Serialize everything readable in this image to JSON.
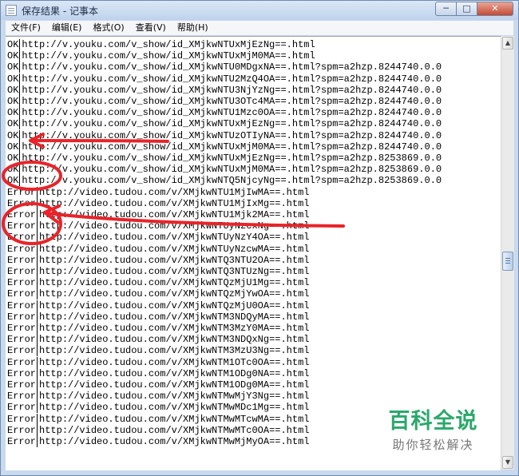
{
  "window": {
    "title": "保存结果 - 记事本",
    "minimize_glyph": "─",
    "maximize_glyph": "□",
    "close_glyph": "✕"
  },
  "menu": [
    {
      "label": "文件(F)"
    },
    {
      "label": "编辑(E)"
    },
    {
      "label": "格式(O)"
    },
    {
      "label": "查看(V)"
    },
    {
      "label": "帮助(H)"
    }
  ],
  "lines": [
    {
      "status": "OK",
      "url": "http://v.youku.com/v_show/id_XMjkwNTUxMjEzNg==.html"
    },
    {
      "status": "OK",
      "url": "http://v.youku.com/v_show/id_XMjkwNTUxMjM0MA==.html"
    },
    {
      "status": "OK",
      "url": "http://v.youku.com/v_show/id_XMjkwNTU0MDgxNA==.html?spm=a2hzp.8244740.0.0"
    },
    {
      "status": "OK",
      "url": "http://v.youku.com/v_show/id_XMjkwNTU2MzQ4OA==.html?spm=a2hzp.8244740.0.0"
    },
    {
      "status": "OK",
      "url": "http://v.youku.com/v_show/id_XMjkwNTU3NjYzNg==.html?spm=a2hzp.8244740.0.0"
    },
    {
      "status": "OK",
      "url": "http://v.youku.com/v_show/id_XMjkwNTU3OTc4MA==.html?spm=a2hzp.8244740.0.0"
    },
    {
      "status": "OK",
      "url": "http://v.youku.com/v_show/id_XMjkwNTU1Mzc0OA==.html?spm=a2hzp.8244740.0.0"
    },
    {
      "status": "OK",
      "url": "http://v.youku.com/v_show/id_XMjkwNTUxMjEzNg==.html?spm=a2hzp.8244740.0.0"
    },
    {
      "status": "OK",
      "url": "http://v.youku.com/v_show/id_XMjkwNTUzOTIyNA==.html?spm=a2hzp.8244740.0.0"
    },
    {
      "status": "OK",
      "url": "http://v.youku.com/v_show/id_XMjkwNTUxMjM0MA==.html?spm=a2hzp.8244740.0.0"
    },
    {
      "status": "OK",
      "url": "http://v.youku.com/v_show/id_XMjkwNTUxMjEzNg==.html?spm=a2hzp.8253869.0.0"
    },
    {
      "status": "OK",
      "url": "http://v.youku.com/v_show/id_XMjkwNTUxMjM0MA==.html?spm=a2hzp.8253869.0.0"
    },
    {
      "status": "OK",
      "url": "http://v.youku.com/v_show/id_XMjkwNTQ5NjcyNg==.html?spm=a2hzp.8253869.0.0"
    },
    {
      "status": "Error",
      "url": "http://video.tudou.com/v/XMjkwNTU1MjIwMA==.html"
    },
    {
      "status": "Error",
      "url": "http://video.tudou.com/v/XMjkwNTU1MjIxMg==.html"
    },
    {
      "status": "Error",
      "url": "http://video.tudou.com/v/XMjkwNTU1Mjk2MA==.html"
    },
    {
      "status": "Error",
      "url": "http://video.tudou.com/v/XMjkwNTUyNzcxNg==.html"
    },
    {
      "status": "Error",
      "url": "http://video.tudou.com/v/XMjkwNTUyNzY4OA==.html"
    },
    {
      "status": "Error",
      "url": "http://video.tudou.com/v/XMjkwNTUyNzcwMA==.html"
    },
    {
      "status": "Error",
      "url": "http://video.tudou.com/v/XMjkwNTQ3NTU2OA==.html"
    },
    {
      "status": "Error",
      "url": "http://video.tudou.com/v/XMjkwNTQ3NTUzNg==.html"
    },
    {
      "status": "Error",
      "url": "http://video.tudou.com/v/XMjkwNTQzMjU1Mg==.html"
    },
    {
      "status": "Error",
      "url": "http://video.tudou.com/v/XMjkwNTQzMjYwOA==.html"
    },
    {
      "status": "Error",
      "url": "http://video.tudou.com/v/XMjkwNTQzMjU0OA==.html"
    },
    {
      "status": "Error",
      "url": "http://video.tudou.com/v/XMjkwNTM3NDQyMA==.html"
    },
    {
      "status": "Error",
      "url": "http://video.tudou.com/v/XMjkwNTM3MzY0MA==.html"
    },
    {
      "status": "Error",
      "url": "http://video.tudou.com/v/XMjkwNTM3NDQxNg==.html"
    },
    {
      "status": "Error",
      "url": "http://video.tudou.com/v/XMjkwNTM3MzU3Ng==.html"
    },
    {
      "status": "Error",
      "url": "http://video.tudou.com/v/XMjkwNTM1OTc0OA==.html"
    },
    {
      "status": "Error",
      "url": "http://video.tudou.com/v/XMjkwNTM1ODg0NA==.html"
    },
    {
      "status": "Error",
      "url": "http://video.tudou.com/v/XMjkwNTM1ODg0MA==.html"
    },
    {
      "status": "Error",
      "url": "http://video.tudou.com/v/XMjkwNTMwMjY3Ng==.html"
    },
    {
      "status": "Error",
      "url": "http://video.tudou.com/v/XMjkwNTMwMDc1Mg==.html"
    },
    {
      "status": "Error",
      "url": "http://video.tudou.com/v/XMjkwNTMwMTcwMA==.html"
    },
    {
      "status": "Error",
      "url": "http://video.tudou.com/v/XMjkwNTMwMTc0OA==.html"
    },
    {
      "status": "Error",
      "url": "http://video.tudou.com/v/XMjkwNTMwMjMyOA==.html"
    }
  ],
  "watermark": {
    "title": "百科全说",
    "subtitle": "助你轻松解决"
  },
  "annotation_color": "#e8242a",
  "watermark_color": "#2aa86b"
}
